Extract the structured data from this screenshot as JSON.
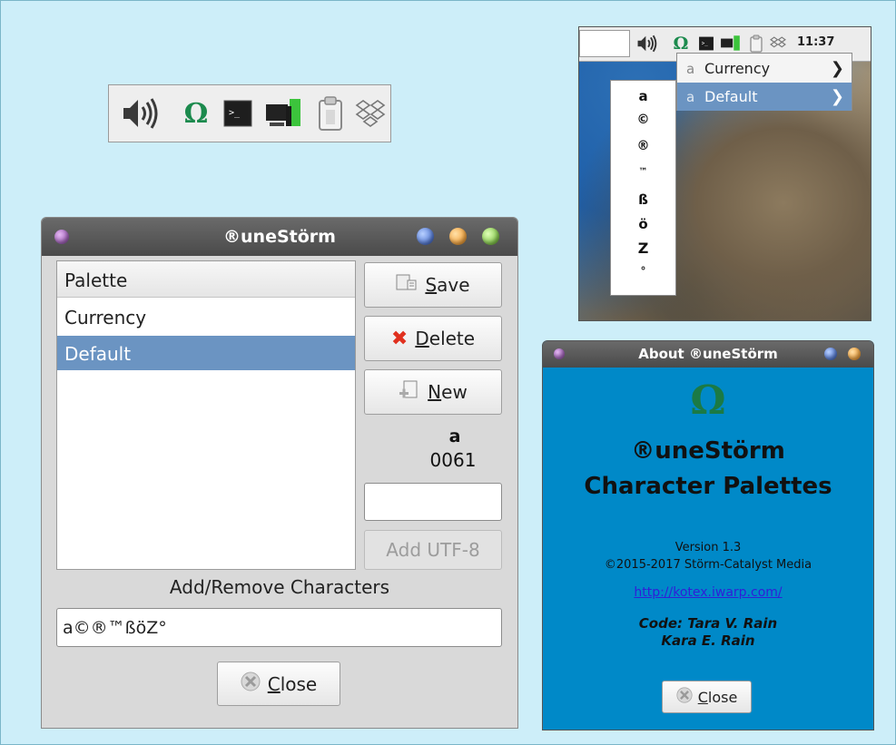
{
  "tray": {
    "icons": [
      "volume-icon",
      "omega-icon",
      "terminal-icon",
      "network-icon",
      "clipboard-icon",
      "dropbox-icon"
    ],
    "omega_glyph": "Ω"
  },
  "desktop": {
    "clock": "11:37",
    "omega_glyph": "Ω",
    "menu": [
      {
        "label": "Currency",
        "selected": false
      },
      {
        "label": "Default",
        "selected": true
      }
    ],
    "submenu_chars": [
      "a",
      "©",
      "®",
      "™",
      "ß",
      "ö",
      "Z",
      "°"
    ]
  },
  "main_window": {
    "title": "®uneStörm",
    "list_header": "Palette",
    "palettes": [
      {
        "label": "Currency",
        "selected": false
      },
      {
        "label": "Default",
        "selected": true
      }
    ],
    "save_rest": "ave",
    "save_key": "S",
    "delete_rest": "elete",
    "delete_key": "D",
    "new_rest": "ew",
    "new_key": "N",
    "current_char": "a",
    "current_code": "0061",
    "utf8_input_value": "",
    "add_utf8_label": "Add UTF-8",
    "characters_label": "Add/Remove Characters",
    "characters_value": "a©®™ßöZ°",
    "close_key": "C",
    "close_rest": "lose"
  },
  "about_window": {
    "title": "About ®uneStörm",
    "omega_glyph": "Ω",
    "app_name": "®uneStörm",
    "subtitle": "Character Palettes",
    "version": "Version 1.3",
    "copyright": "©2015-2017 Störm-Catalyst Media",
    "link": "http://kotex.iwarp.com/",
    "credit1": "Code: Tara V. Rain",
    "credit2": "Kara E. Rain",
    "close_key": "C",
    "close_rest": "lose"
  },
  "colors": {
    "background": "#cdeef9",
    "selection": "#6b94c2",
    "about_bg": "#0089c8",
    "omega": "#1b8a4d"
  }
}
